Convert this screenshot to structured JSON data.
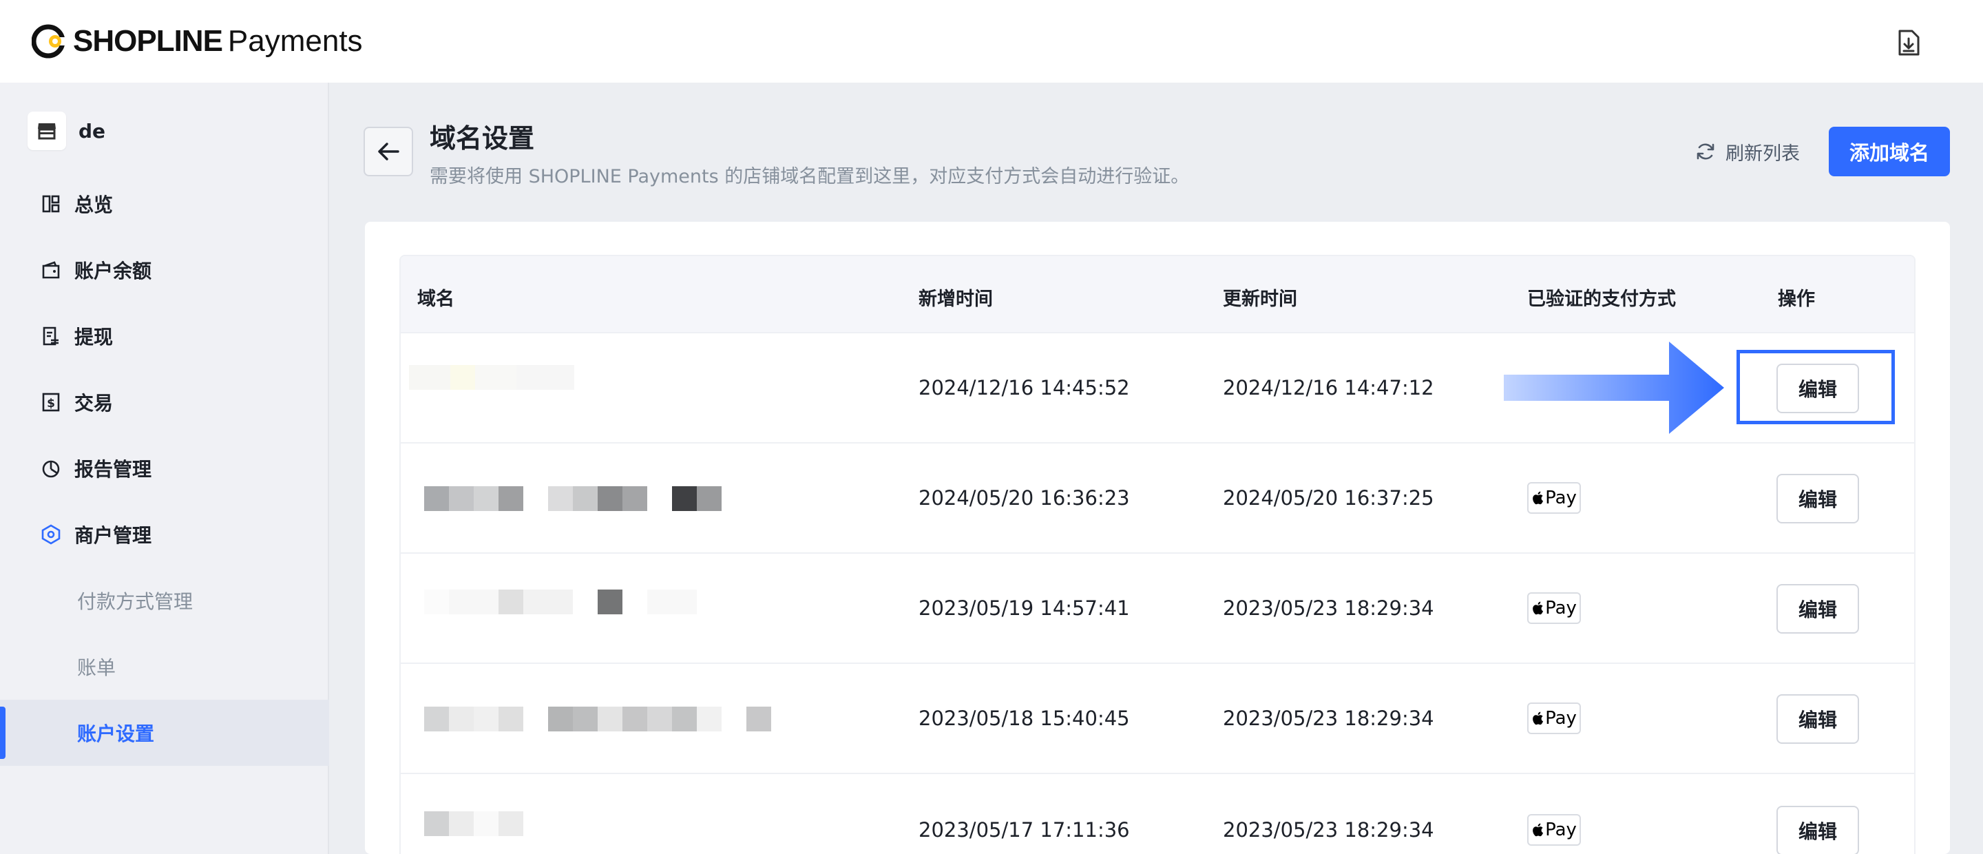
{
  "brand": {
    "name_strong": "SHOPLINE",
    "name_light": "Payments",
    "accent": "#2f6bff"
  },
  "topbar": {
    "download_icon": "download-icon"
  },
  "sidebar": {
    "store_name": "de",
    "store_icon": "store-icon",
    "items": [
      {
        "label": "总览",
        "icon": "dashboard-icon"
      },
      {
        "label": "账户余额",
        "icon": "wallet-icon"
      },
      {
        "label": "提现",
        "icon": "withdraw-icon"
      },
      {
        "label": "交易",
        "icon": "dollar-icon"
      },
      {
        "label": "报告管理",
        "icon": "pie-chart-icon"
      },
      {
        "label": "商户管理",
        "icon": "merchant-icon"
      }
    ],
    "sub_items": [
      {
        "label": "付款方式管理"
      },
      {
        "label": "账单"
      },
      {
        "label": "账户设置",
        "active": true
      }
    ]
  },
  "header": {
    "title": "域名设置",
    "subtitle": "需要将使用 SHOPLINE Payments 的店铺域名配置到这里，对应支付方式会自动进行验证。",
    "refresh_label": "刷新列表",
    "add_label": "添加域名"
  },
  "table": {
    "columns": [
      "域名",
      "新增时间",
      "更新时间",
      "已验证的支付方式",
      "操作"
    ],
    "rows": [
      {
        "domain": "",
        "created": "2024/12/16 14:45:52",
        "updated": "2024/12/16 14:47:12",
        "payment": "",
        "action": "编辑"
      },
      {
        "domain": "",
        "created": "2024/05/20 16:36:23",
        "updated": "2024/05/20 16:37:25",
        "payment": "Pay",
        "action": "编辑"
      },
      {
        "domain": "",
        "created": "2023/05/19 14:57:41",
        "updated": "2023/05/23 18:29:34",
        "payment": "Pay",
        "action": "编辑"
      },
      {
        "domain": "",
        "created": "2023/05/18 15:40:45",
        "updated": "2023/05/23 18:29:34",
        "payment": "Pay",
        "action": "编辑"
      },
      {
        "domain": "",
        "created": "2023/05/17 17:11:36",
        "updated": "2023/05/23 18:29:34",
        "payment": "Pay",
        "action": "编辑"
      }
    ]
  }
}
